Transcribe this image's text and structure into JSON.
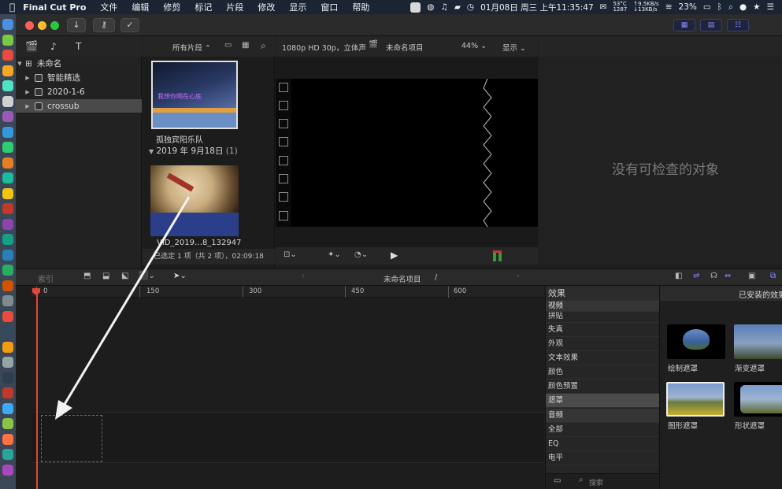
{
  "menubar": {
    "app": "Final Cut Pro",
    "items": [
      "文件",
      "编辑",
      "修剪",
      "标记",
      "片段",
      "修改",
      "显示",
      "窗口",
      "帮助"
    ],
    "datetime": "01月08日 周三 上午11:35:47",
    "cpu_temp": "53°C",
    "fan": "1287",
    "net_up": "↑9.5KB/s",
    "net_down": "↓13KB/s",
    "battery": "23%"
  },
  "libraries": {
    "root": "未命名",
    "items": [
      "智能精选",
      "2020-1-6",
      "crossub"
    ],
    "selected": "crossub"
  },
  "browser": {
    "filter": "所有片段",
    "clip1_name": "孤独宾阳乐队",
    "clip1_overlay": "我想你啊在心底",
    "date_group": "2019 年 9月18日",
    "date_count": "(1)",
    "clip2_name": "VID_2019…8_132947",
    "status": "已选定 1 项（共 2 项），02:09:18"
  },
  "viewer": {
    "format": "1080p HD 30p，立体声",
    "project": "未命名项目",
    "zoom": "44%",
    "view_menu": "显示"
  },
  "inspector": {
    "empty": "没有可检查的对象"
  },
  "timeline": {
    "index_label": "索引",
    "project": "未命名项目",
    "separator": "/",
    "ruler": [
      "0",
      "150",
      "300",
      "450",
      "600"
    ]
  },
  "effects": {
    "header": "效果",
    "installed": "已安装的效果",
    "categories": [
      {
        "label": "视频",
        "header": true
      },
      {
        "label": "拼贴"
      },
      {
        "label": "失真"
      },
      {
        "label": "外观"
      },
      {
        "label": "文本效果"
      },
      {
        "label": "颜色"
      },
      {
        "label": "颜色预置"
      },
      {
        "label": "遮罩",
        "selected": true
      },
      {
        "label": "音频",
        "header": true
      },
      {
        "label": "全部"
      },
      {
        "label": "EQ"
      },
      {
        "label": "电平"
      }
    ],
    "thumbs": [
      "绘制遮罩",
      "渐变遮罩",
      "图形遮罩",
      "形状遮罩"
    ],
    "search_placeholder": "搜索"
  },
  "colors": {
    "accent": "#7b7dff",
    "playhead": "#e0463a",
    "selection": "#4a4a4a"
  }
}
